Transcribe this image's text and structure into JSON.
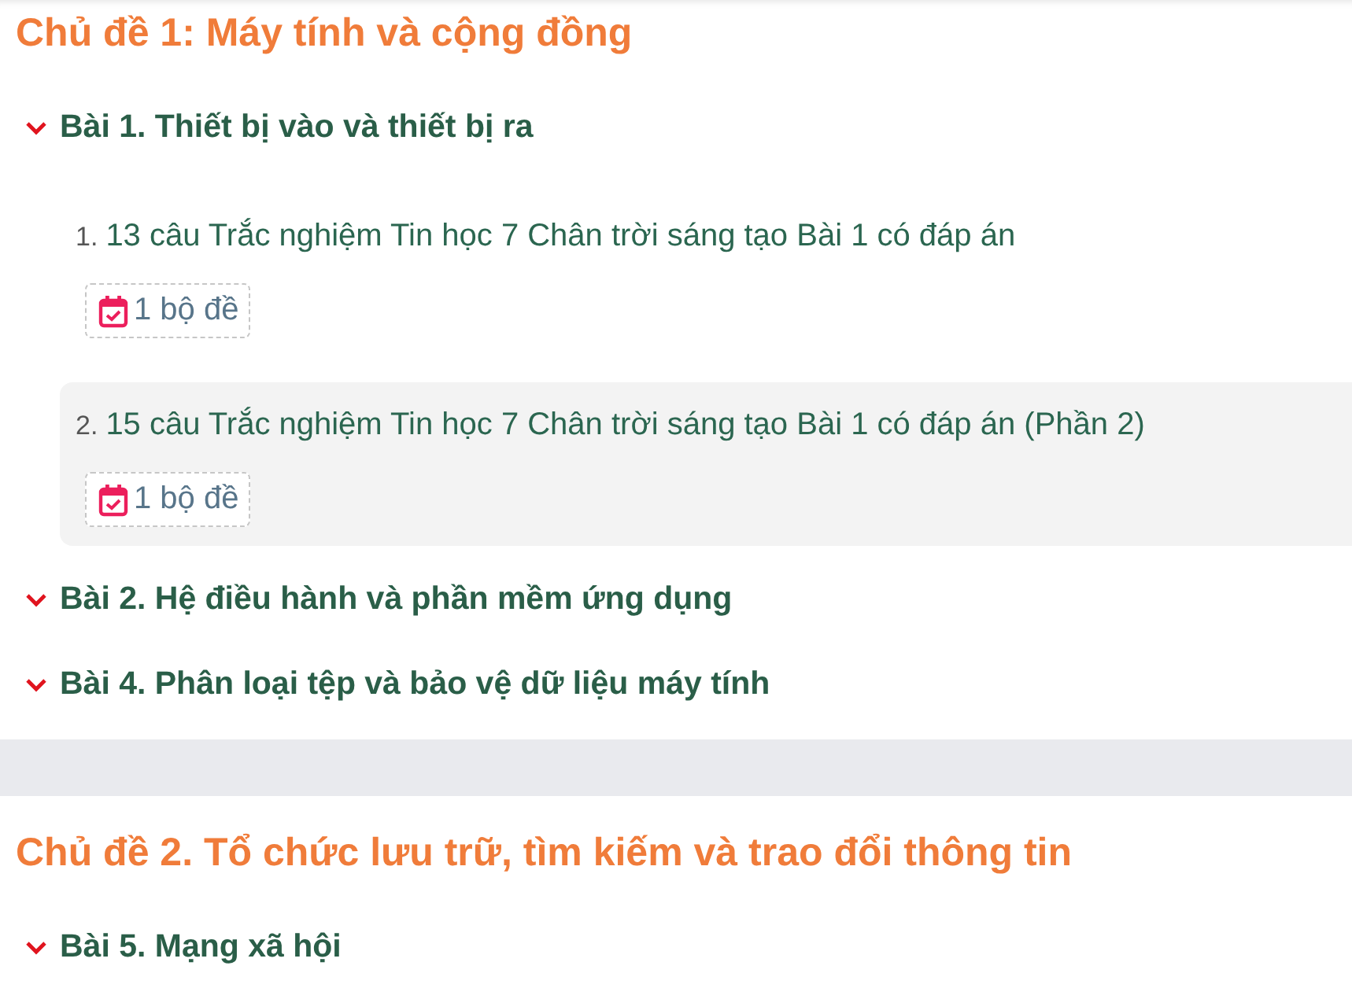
{
  "sections": [
    {
      "title": "Chủ đề 1: Máy tính và cộng đồng",
      "lessons": [
        {
          "title": "Bài 1. Thiết bị vào và thiết bị ra",
          "items": [
            {
              "number": "1.",
              "title": "13 câu Trắc nghiệm Tin học 7 Chân trời sáng tạo Bài 1 có đáp án",
              "badge": "1 bộ đề",
              "selected": false
            },
            {
              "number": "2.",
              "title": "15 câu Trắc nghiệm Tin học 7 Chân trời sáng tạo Bài 1 có đáp án (Phần 2)",
              "badge": "1 bộ đề",
              "selected": true
            }
          ]
        },
        {
          "title": "Bài 2. Hệ điều hành và phần mềm ứng dụng"
        },
        {
          "title": "Bài 4. Phân loại tệp và bảo vệ dữ liệu máy tính"
        }
      ]
    },
    {
      "title": "Chủ đề 2. Tổ chức lưu trữ, tìm kiếm và trao đổi thông tin",
      "lessons": [
        {
          "title": "Bài 5. Mạng xã hội"
        }
      ]
    }
  ]
}
